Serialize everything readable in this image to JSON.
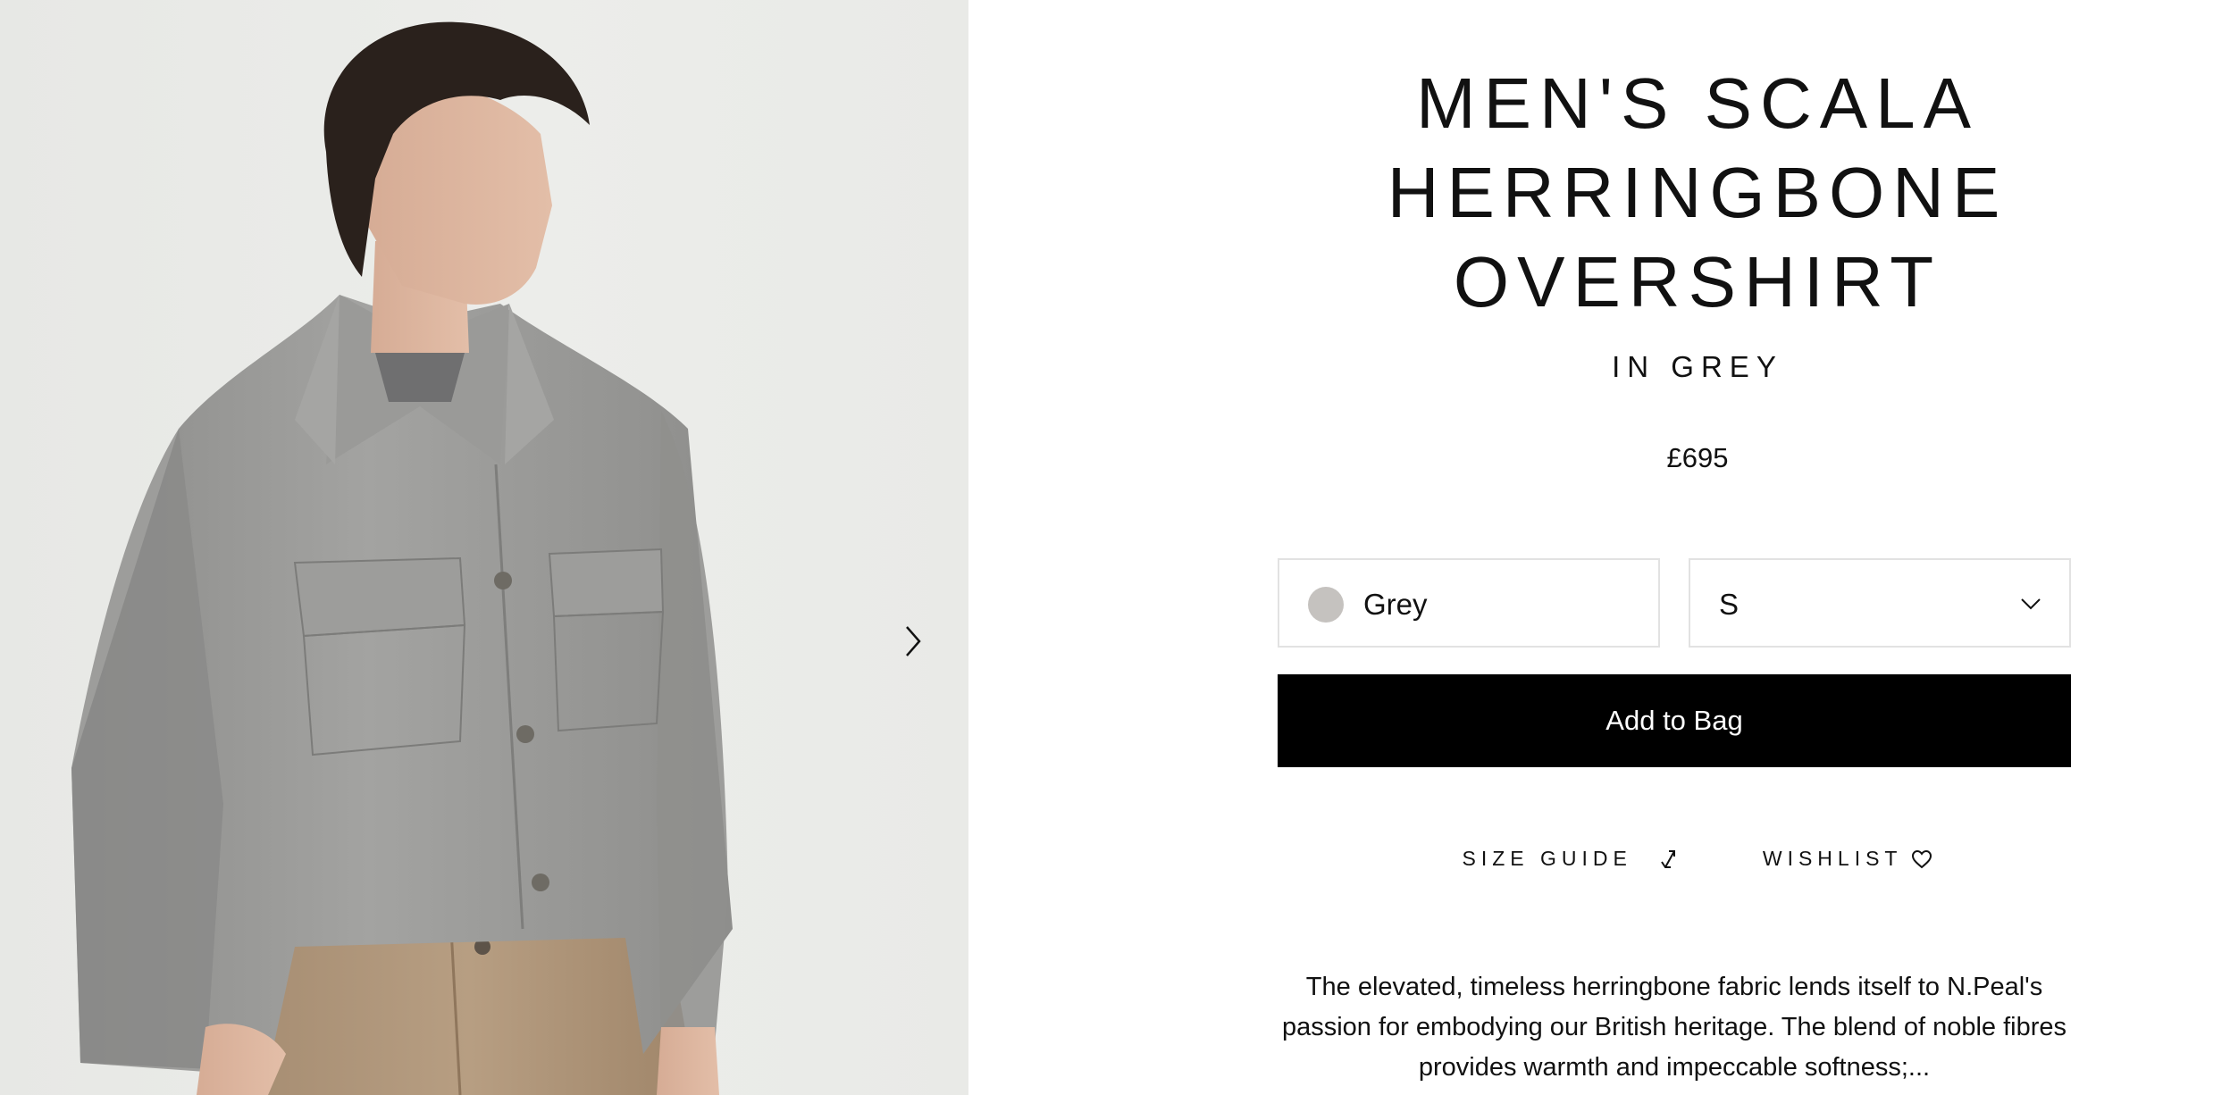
{
  "product": {
    "title_lines": [
      "MEN'S SCALA",
      "HERRINGBONE",
      "OVERSHIRT"
    ],
    "subtitle": "IN GREY",
    "price": "£695",
    "color_selector": {
      "value": "Grey",
      "swatch_color": "#c5c2bf"
    },
    "size_selector": {
      "value": "S"
    },
    "add_to_bag_label": "Add to Bag",
    "size_guide_label": "SIZE GUIDE",
    "wishlist_label": "WISHLIST",
    "description": "The elevated, timeless herringbone fabric lends itself to N.Peal's passion for embodying our British heritage. The blend of noble fibres provides warmth and impeccable softness;..."
  },
  "gallery": {
    "next_icon": "chevron-right-icon"
  },
  "colors": {
    "button_bg": "#000000",
    "button_text": "#ffffff",
    "border": "#e2e2e2"
  }
}
